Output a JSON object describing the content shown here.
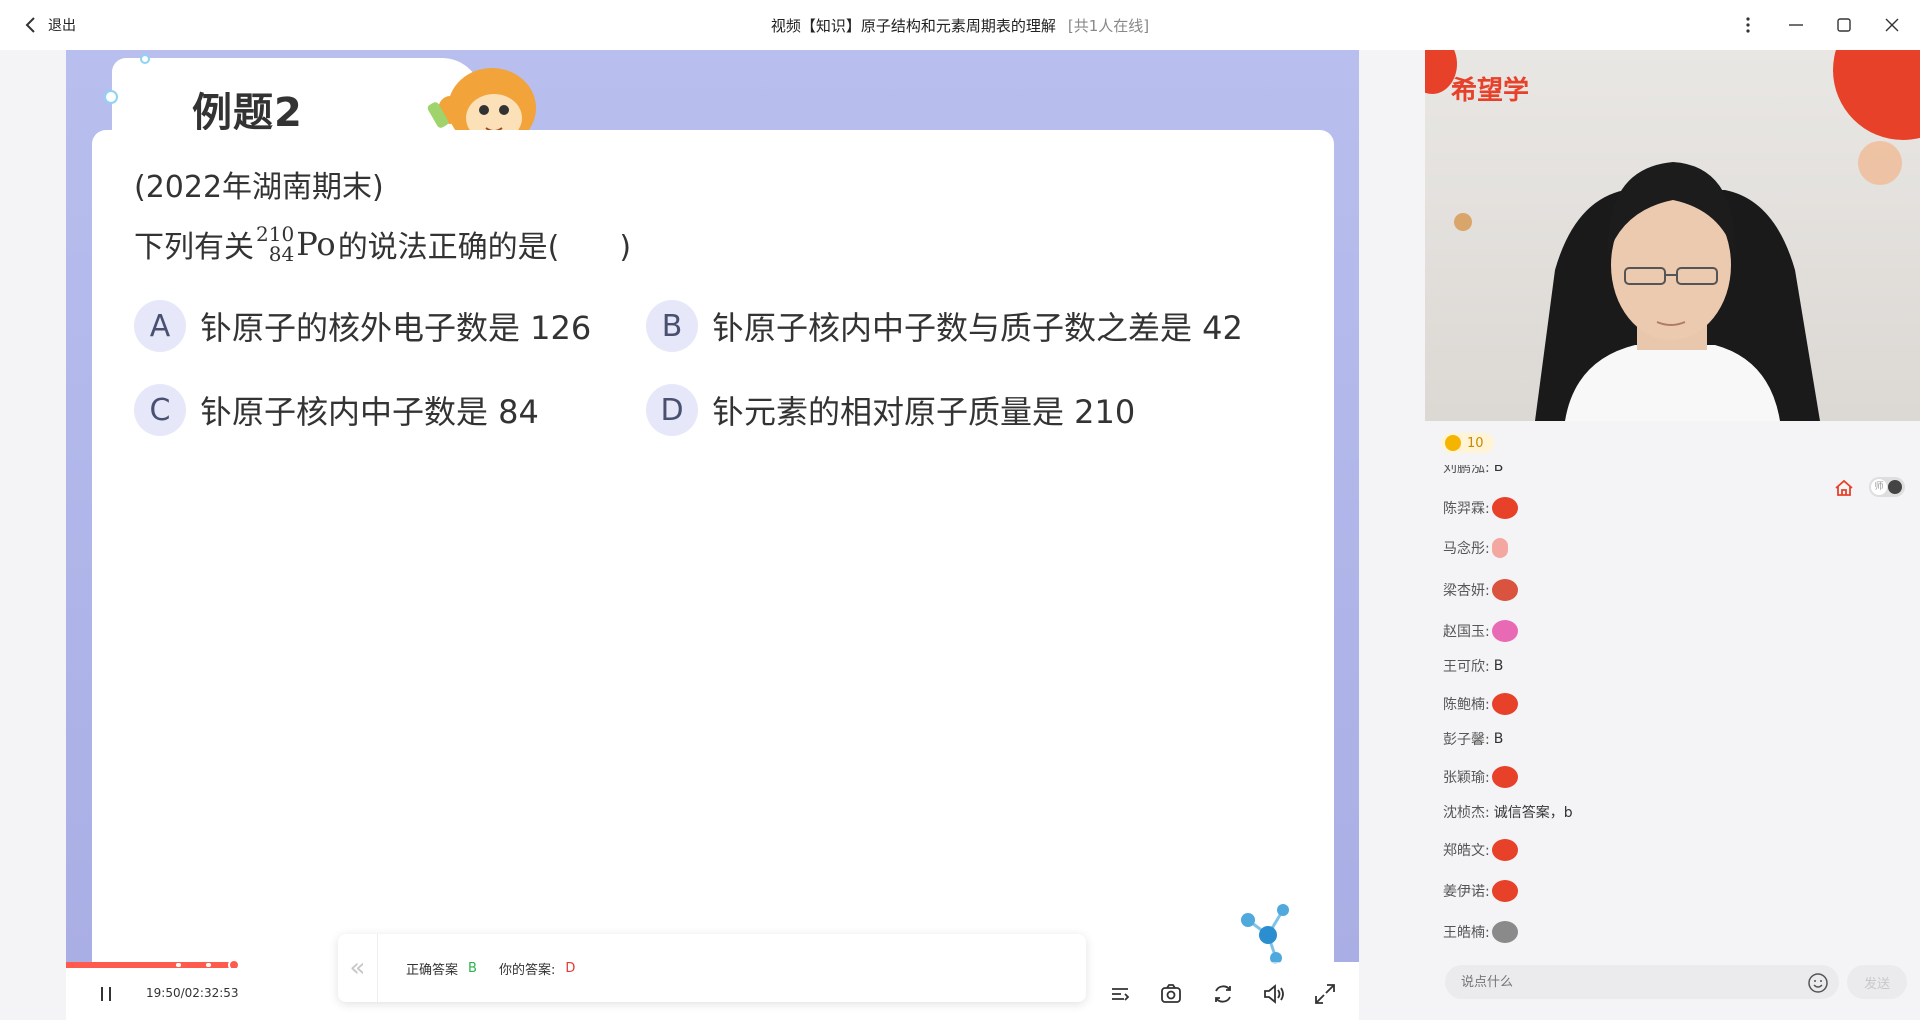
{
  "titlebar": {
    "back_label": "退出",
    "title": "视频【知识】原子结构和元素周期表的理解",
    "online": "[共1人在线]"
  },
  "slide": {
    "heading": "例题2",
    "source": "(2022年湖南期末)",
    "question_prefix": "下列有关",
    "nuclide_mass": "210",
    "nuclide_atomic": "84",
    "nuclide_symbol": "Po",
    "question_suffix": "的说法正确的是(　　)",
    "options": [
      {
        "letter": "A",
        "text": "钋原子的核外电子数是 126"
      },
      {
        "letter": "B",
        "text": "钋原子核内中子数与质子数之差是 42"
      },
      {
        "letter": "C",
        "text": "钋原子核内中子数是 84"
      },
      {
        "letter": "D",
        "text": "钋元素的相对原子质量是 210"
      }
    ]
  },
  "player": {
    "time": "19:50/02:32:53",
    "progress_fraction": 0.13,
    "accent": "#ff5a4e"
  },
  "answer": {
    "correct_label": "正确答案",
    "correct_value": "B",
    "mine_label": "你的答案:",
    "mine_value": "D"
  },
  "camera": {
    "brand": "希望学"
  },
  "chat": {
    "coins": "10",
    "teacher_toggle": "师",
    "messages": [
      {
        "name": "刘鹏泓:",
        "text": "B",
        "emoji": null
      },
      {
        "name": "陈羿霖:",
        "text": "",
        "emoji": "mouth-emoji"
      },
      {
        "name": "马念彤:",
        "text": "",
        "emoji": "hand-emoji"
      },
      {
        "name": "梁杏妍:",
        "text": "",
        "emoji": "monkey-emoji"
      },
      {
        "name": "赵国玉:",
        "text": "",
        "emoji": "heart-emoji"
      },
      {
        "name": "王可欣:",
        "text": "B",
        "emoji": null
      },
      {
        "name": "陈鲍楠:",
        "text": "",
        "emoji": "mouth-emoji"
      },
      {
        "name": "彭子馨:",
        "text": "B",
        "emoji": null
      },
      {
        "name": "张颖瑜:",
        "text": "",
        "emoji": "mouth-emoji"
      },
      {
        "name": "沈桢杰:",
        "text": "诚信答案，b",
        "emoji": null
      },
      {
        "name": "郑皓文:",
        "text": "",
        "emoji": "mouth-emoji"
      },
      {
        "name": "姜伊诺:",
        "text": "",
        "emoji": "mouth-emoji"
      },
      {
        "name": "王皓楠:",
        "text": "",
        "emoji": "monkey-emoji"
      }
    ],
    "input_placeholder": "说点什么",
    "send_label": "发送"
  }
}
